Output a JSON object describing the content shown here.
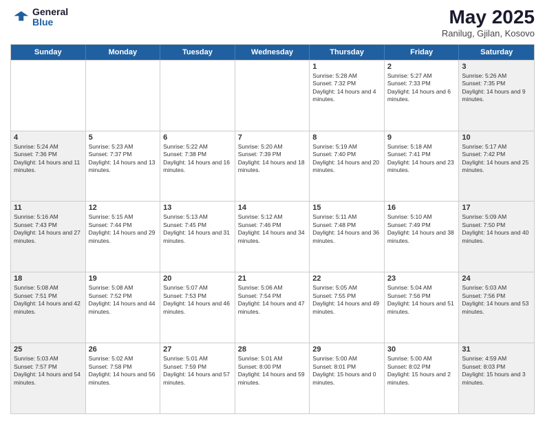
{
  "logo": {
    "general": "General",
    "blue": "Blue"
  },
  "header": {
    "month_year": "May 2025",
    "location": "Ranilug, Gjilan, Kosovo"
  },
  "weekdays": [
    "Sunday",
    "Monday",
    "Tuesday",
    "Wednesday",
    "Thursday",
    "Friday",
    "Saturday"
  ],
  "weeks": [
    [
      {
        "day": "",
        "empty": true
      },
      {
        "day": "",
        "empty": true
      },
      {
        "day": "",
        "empty": true
      },
      {
        "day": "",
        "empty": true
      },
      {
        "day": "1",
        "sunrise": "5:28 AM",
        "sunset": "7:32 PM",
        "daylight": "14 hours and 4 minutes."
      },
      {
        "day": "2",
        "sunrise": "5:27 AM",
        "sunset": "7:33 PM",
        "daylight": "14 hours and 6 minutes."
      },
      {
        "day": "3",
        "sunrise": "5:26 AM",
        "sunset": "7:35 PM",
        "daylight": "14 hours and 9 minutes."
      }
    ],
    [
      {
        "day": "4",
        "sunrise": "5:24 AM",
        "sunset": "7:36 PM",
        "daylight": "14 hours and 11 minutes."
      },
      {
        "day": "5",
        "sunrise": "5:23 AM",
        "sunset": "7:37 PM",
        "daylight": "14 hours and 13 minutes."
      },
      {
        "day": "6",
        "sunrise": "5:22 AM",
        "sunset": "7:38 PM",
        "daylight": "14 hours and 16 minutes."
      },
      {
        "day": "7",
        "sunrise": "5:20 AM",
        "sunset": "7:39 PM",
        "daylight": "14 hours and 18 minutes."
      },
      {
        "day": "8",
        "sunrise": "5:19 AM",
        "sunset": "7:40 PM",
        "daylight": "14 hours and 20 minutes."
      },
      {
        "day": "9",
        "sunrise": "5:18 AM",
        "sunset": "7:41 PM",
        "daylight": "14 hours and 23 minutes."
      },
      {
        "day": "10",
        "sunrise": "5:17 AM",
        "sunset": "7:42 PM",
        "daylight": "14 hours and 25 minutes."
      }
    ],
    [
      {
        "day": "11",
        "sunrise": "5:16 AM",
        "sunset": "7:43 PM",
        "daylight": "14 hours and 27 minutes."
      },
      {
        "day": "12",
        "sunrise": "5:15 AM",
        "sunset": "7:44 PM",
        "daylight": "14 hours and 29 minutes."
      },
      {
        "day": "13",
        "sunrise": "5:13 AM",
        "sunset": "7:45 PM",
        "daylight": "14 hours and 31 minutes."
      },
      {
        "day": "14",
        "sunrise": "5:12 AM",
        "sunset": "7:46 PM",
        "daylight": "14 hours and 34 minutes."
      },
      {
        "day": "15",
        "sunrise": "5:11 AM",
        "sunset": "7:48 PM",
        "daylight": "14 hours and 36 minutes."
      },
      {
        "day": "16",
        "sunrise": "5:10 AM",
        "sunset": "7:49 PM",
        "daylight": "14 hours and 38 minutes."
      },
      {
        "day": "17",
        "sunrise": "5:09 AM",
        "sunset": "7:50 PM",
        "daylight": "14 hours and 40 minutes."
      }
    ],
    [
      {
        "day": "18",
        "sunrise": "5:08 AM",
        "sunset": "7:51 PM",
        "daylight": "14 hours and 42 minutes."
      },
      {
        "day": "19",
        "sunrise": "5:08 AM",
        "sunset": "7:52 PM",
        "daylight": "14 hours and 44 minutes."
      },
      {
        "day": "20",
        "sunrise": "5:07 AM",
        "sunset": "7:53 PM",
        "daylight": "14 hours and 46 minutes."
      },
      {
        "day": "21",
        "sunrise": "5:06 AM",
        "sunset": "7:54 PM",
        "daylight": "14 hours and 47 minutes."
      },
      {
        "day": "22",
        "sunrise": "5:05 AM",
        "sunset": "7:55 PM",
        "daylight": "14 hours and 49 minutes."
      },
      {
        "day": "23",
        "sunrise": "5:04 AM",
        "sunset": "7:56 PM",
        "daylight": "14 hours and 51 minutes."
      },
      {
        "day": "24",
        "sunrise": "5:03 AM",
        "sunset": "7:56 PM",
        "daylight": "14 hours and 53 minutes."
      }
    ],
    [
      {
        "day": "25",
        "sunrise": "5:03 AM",
        "sunset": "7:57 PM",
        "daylight": "14 hours and 54 minutes."
      },
      {
        "day": "26",
        "sunrise": "5:02 AM",
        "sunset": "7:58 PM",
        "daylight": "14 hours and 56 minutes."
      },
      {
        "day": "27",
        "sunrise": "5:01 AM",
        "sunset": "7:59 PM",
        "daylight": "14 hours and 57 minutes."
      },
      {
        "day": "28",
        "sunrise": "5:01 AM",
        "sunset": "8:00 PM",
        "daylight": "14 hours and 59 minutes."
      },
      {
        "day": "29",
        "sunrise": "5:00 AM",
        "sunset": "8:01 PM",
        "daylight": "15 hours and 0 minutes."
      },
      {
        "day": "30",
        "sunrise": "5:00 AM",
        "sunset": "8:02 PM",
        "daylight": "15 hours and 2 minutes."
      },
      {
        "day": "31",
        "sunrise": "4:59 AM",
        "sunset": "8:03 PM",
        "daylight": "15 hours and 3 minutes."
      }
    ]
  ]
}
